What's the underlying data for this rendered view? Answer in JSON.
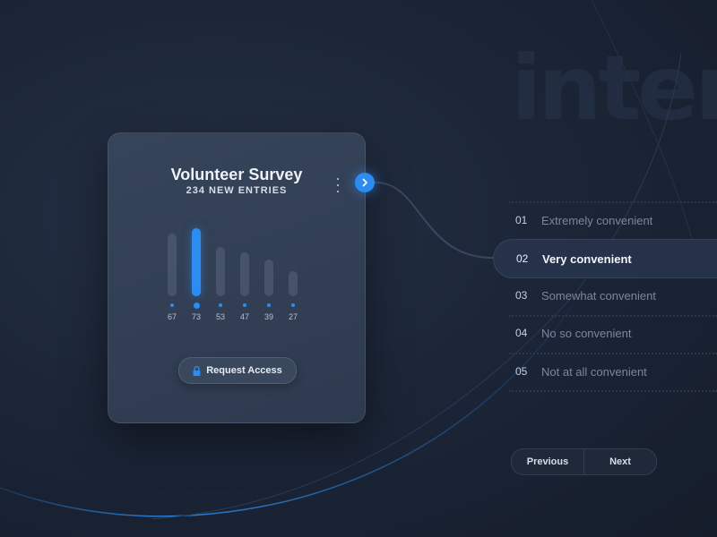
{
  "background_word": "inter",
  "card": {
    "title": "Volunteer Survey",
    "subtitle": "234 NEW ENTRIES",
    "menu_icon": "more-vertical-icon",
    "next_icon": "chevron-right-icon",
    "request_button": {
      "label": "Request Access",
      "icon": "lock-icon"
    }
  },
  "chart_data": {
    "type": "bar",
    "categories": [
      "67",
      "73",
      "53",
      "47",
      "39",
      "27"
    ],
    "values": [
      67,
      73,
      53,
      47,
      39,
      27
    ],
    "highlighted_index": 1,
    "title": "",
    "xlabel": "",
    "ylabel": "",
    "ylim": [
      0,
      73
    ]
  },
  "options": [
    {
      "num": "01",
      "label": "Extremely convenient",
      "selected": false
    },
    {
      "num": "02",
      "label": "Very convenient",
      "selected": true
    },
    {
      "num": "03",
      "label": "Somewhat convenient",
      "selected": false
    },
    {
      "num": "04",
      "label": "No so convenient",
      "selected": false
    },
    {
      "num": "05",
      "label": "Not at all convenient",
      "selected": false
    }
  ],
  "pager": {
    "previous": "Previous",
    "next": "Next"
  },
  "colors": {
    "accent": "#2d8cf0",
    "card": "#323f54",
    "background": "#1c2638"
  }
}
